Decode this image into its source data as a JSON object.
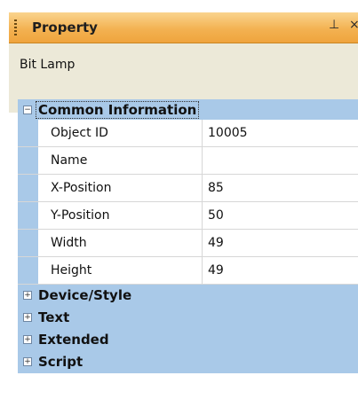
{
  "titlebar": {
    "title": "Property",
    "pin_glyph": "⊥",
    "close_glyph": "×"
  },
  "object": {
    "name": "Bit Lamp"
  },
  "common": {
    "label": "Common Information",
    "expander": "−",
    "rows": [
      {
        "key": "Object ID",
        "value": "10005"
      },
      {
        "key": "Name",
        "value": ""
      },
      {
        "key": "X-Position",
        "value": "85"
      },
      {
        "key": "Y-Position",
        "value": "50"
      },
      {
        "key": "Width",
        "value": "49"
      },
      {
        "key": "Height",
        "value": "49"
      }
    ]
  },
  "categories": [
    {
      "label": "Device/Style",
      "expander": "+"
    },
    {
      "label": "Text",
      "expander": "+"
    },
    {
      "label": "Extended",
      "expander": "+"
    },
    {
      "label": "Script",
      "expander": "+"
    }
  ],
  "colors": {
    "titlebar": "#f3b252",
    "category": "#a9c9e8",
    "objbar": "#ece9d8"
  }
}
